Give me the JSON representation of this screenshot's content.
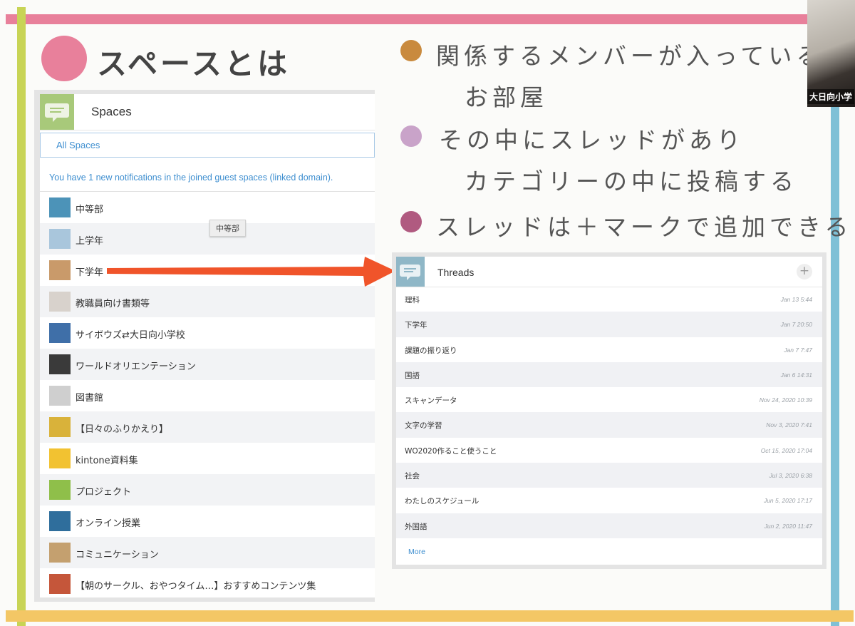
{
  "slide": {
    "title": "スペースとは",
    "bullets": [
      {
        "lines": [
          "関係するメンバーが入っている",
          "お部屋"
        ],
        "color": "#c98a3e"
      },
      {
        "lines": [
          "その中にスレッドがあり",
          "カテゴリーの中に投稿する"
        ],
        "color": "#c9a3c9"
      },
      {
        "lines": [
          "スレッドは＋マークで追加できる"
        ],
        "color": "#b05a80"
      }
    ],
    "colors": {
      "top_line": "#e8809b",
      "left_line": "#c8d456",
      "right_line": "#7fc0d6",
      "bottom_line": "#f3c765",
      "title_dot": "#e8809b"
    }
  },
  "video": {
    "participant_name": "大日向小学"
  },
  "spaces": {
    "header_title": "Spaces",
    "header_icon": "speech-bubble-icon",
    "tab_label": "All Spaces",
    "notification": "You have 1 new notifications in the joined guest spaces (linked domain).",
    "tooltip": "中等部",
    "items": [
      {
        "name": "中等部",
        "thumb": "#4c93b8"
      },
      {
        "name": "上学年",
        "thumb": "#a9c6dc"
      },
      {
        "name": "下学年",
        "thumb": "#c99a6a"
      },
      {
        "name": "教職員向け書類等",
        "thumb": "#d8d2cc"
      },
      {
        "name": "サイボウズ⇄大日向小学校",
        "thumb": "#3f6fa8"
      },
      {
        "name": "ワールドオリエンテーション",
        "thumb": "#3a3a3a"
      },
      {
        "name": "図書館",
        "thumb": "#cfcfcf"
      },
      {
        "name": "【日々のふりかえり】",
        "thumb": "#d9b23a"
      },
      {
        "name": "kintone資料集",
        "thumb": "#f2c231"
      },
      {
        "name": "プロジェクト",
        "thumb": "#8fbf4a"
      },
      {
        "name": "オンライン授業",
        "thumb": "#2f6e9c"
      },
      {
        "name": "コミュニケーション",
        "thumb": "#c4a06f"
      },
      {
        "name": "【朝のサークル、おやつタイム…】おすすめコンテンツ集",
        "thumb": "#c5563a"
      }
    ]
  },
  "threads": {
    "title": "Threads",
    "add_label": "+",
    "more_label": "More",
    "items": [
      {
        "name": "理科",
        "time": "Jan 13 5:44"
      },
      {
        "name": "下学年",
        "time": "Jan 7 20:50"
      },
      {
        "name": "課題の振り返り",
        "time": "Jan 7 7:47"
      },
      {
        "name": "国語",
        "time": "Jan 6 14:31"
      },
      {
        "name": "スキャンデータ",
        "time": "Nov 24, 2020 10:39"
      },
      {
        "name": "文字の学習",
        "time": "Nov 3, 2020 7:41"
      },
      {
        "name": "WO2020作ること使うこと",
        "time": "Oct 15, 2020 17:04"
      },
      {
        "name": "社会",
        "time": "Jul 3, 2020 6:38"
      },
      {
        "name": "わたしのスケジュール",
        "time": "Jun 5, 2020 17:17"
      },
      {
        "name": "外国語",
        "time": "Jun 2, 2020 11:47"
      }
    ]
  },
  "arrow": {
    "color": "#f0542a"
  }
}
